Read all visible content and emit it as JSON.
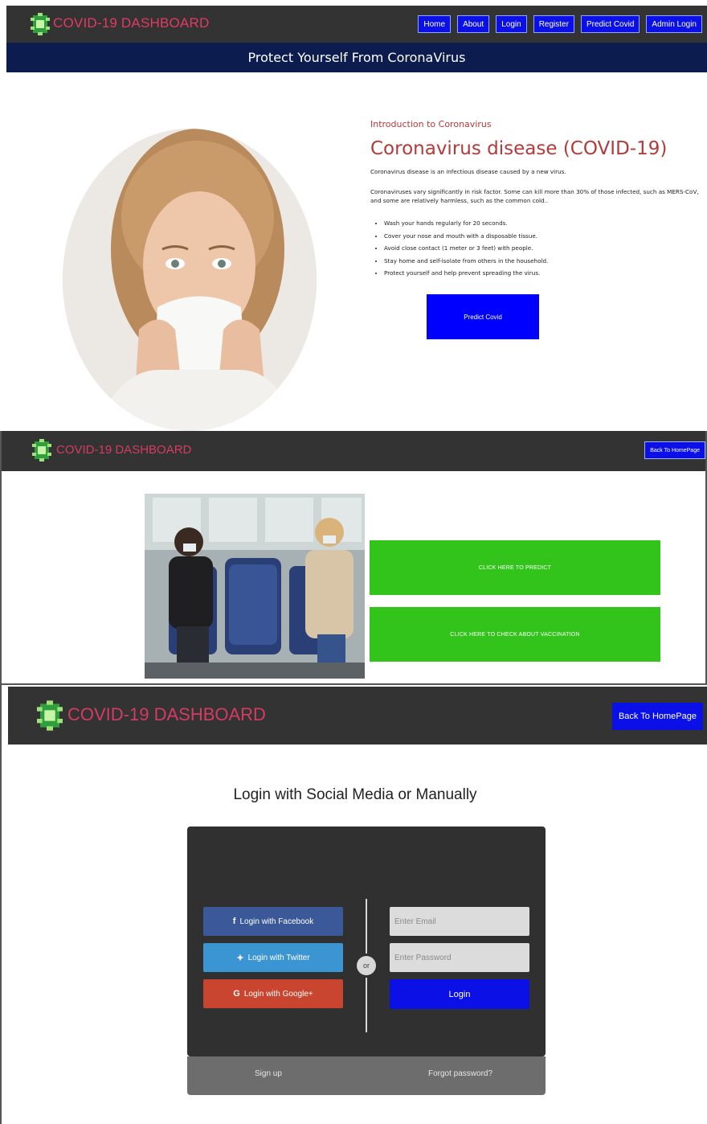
{
  "brand": {
    "name": "COVID-19 DASHBOARD"
  },
  "home": {
    "nav": [
      {
        "label": "Home"
      },
      {
        "label": "About"
      },
      {
        "label": "Login"
      },
      {
        "label": "Register"
      },
      {
        "label": "Predict Covid"
      },
      {
        "label": "Admin Login"
      }
    ],
    "banner": "Protect Yourself From CoronaVirus",
    "eyebrow": "Introduction to Coronavirus",
    "title": "Coronavirus disease (COVID-19)",
    "para1": "Coronavirus disease is an infectious disease caused by a new virus.",
    "para2": "Coronaviruses vary significantly in risk factor. Some can kill more than 30% of those infected, such as MERS-CoV, and some are relatively harmless, such as the common cold..",
    "tips": [
      "Wash your hands regularly for 20 seconds.",
      "Cover your nose and mouth with a disposable tissue.",
      "Avoid close contact (1 meter or 3 feet) with people.",
      "Stay home and self-isolate from others in the household.",
      "Protect yourself and help prevent spreading the virus."
    ],
    "predict_label": "Predict Covid"
  },
  "choice": {
    "back_label": "Back To HomePage",
    "predict_label": "CLICK HERE TO PREDICT",
    "vaccine_label": "CLICK HERE TO CHECK ABOUT VACCINATION"
  },
  "login": {
    "back_label": "Back To HomePage",
    "heading": "Login with Social Media or Manually",
    "facebook": "Login with Facebook",
    "twitter": "Login with Twitter",
    "google": "Login with Google+",
    "or": "or",
    "email_placeholder": "Enter Email",
    "password_placeholder": "Enter Password",
    "submit": "Login",
    "signup": "Sign up",
    "forgot": "Forgot password?"
  },
  "colors": {
    "navbar": "#333333",
    "brand_pink": "#e23b63",
    "accent_blue": "#0a10e6",
    "green": "#33c41c",
    "banner_navy": "#0c1c4f",
    "facebook": "#3b5998",
    "twitter": "#3b95d3",
    "google": "#c9452f"
  }
}
